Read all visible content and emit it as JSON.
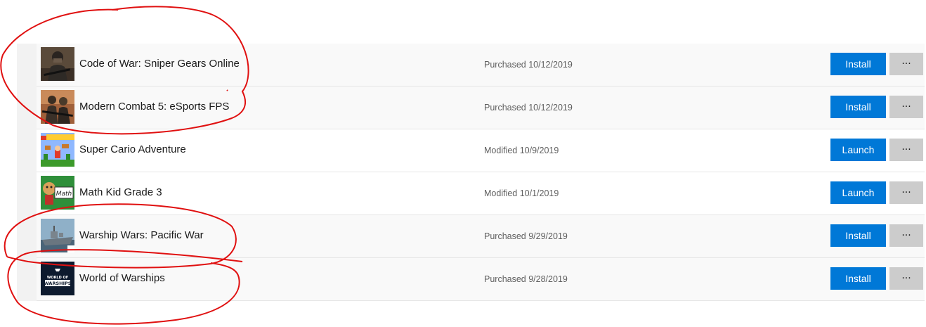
{
  "apps": [
    {
      "title": "Code of War: Sniper Gears Online",
      "status": "Purchased 10/12/2019",
      "action": "Install",
      "more": "···",
      "icon": "code-of-war-soldier-icon"
    },
    {
      "title": "Modern Combat 5: eSports FPS",
      "status": "Purchased 10/12/2019",
      "action": "Install",
      "more": "···",
      "icon": "modern-combat-soldier-icon"
    },
    {
      "title": "Super Cario Adventure",
      "status": "Modified 10/9/2019",
      "action": "Launch",
      "more": "···",
      "icon": "super-cario-platformer-icon"
    },
    {
      "title": "Math Kid Grade 3",
      "status": "Modified 10/1/2019",
      "action": "Launch",
      "more": "···",
      "icon": "math-kid-chalkboard-icon"
    },
    {
      "title": "Warship Wars: Pacific War",
      "status": "Purchased 9/29/2019",
      "action": "Install",
      "more": "···",
      "icon": "warship-icon"
    },
    {
      "title": "World of Warships",
      "status": "Purchased 9/28/2019",
      "action": "Install",
      "more": "···",
      "icon": "world-of-warships-logo-icon"
    }
  ],
  "colors": {
    "accent": "#0078d7",
    "more_button": "#cccccc",
    "annotation_ink": "#e01010"
  },
  "world_of_warships_logo_text": "WORLD OF WARSHIPS",
  "math_kid_board_text": "Math"
}
